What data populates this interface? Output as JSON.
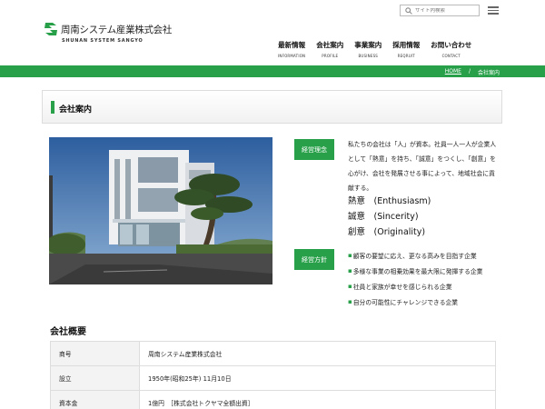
{
  "header": {
    "search": {
      "placeholder": "サイト内検索"
    },
    "logo": {
      "jp": "周南システム産業株式会社",
      "en": "SHUNAN SYSTEM SANGYO"
    },
    "nav": [
      {
        "jp": "最新情報",
        "en": "INFORMATION"
      },
      {
        "jp": "会社案内",
        "en": "PROFILE"
      },
      {
        "jp": "事業案内",
        "en": "BUSINESS"
      },
      {
        "jp": "採用情報",
        "en": "REQRUIT"
      },
      {
        "jp": "お問い合わせ",
        "en": "CONTACT"
      }
    ]
  },
  "breadcrumb": {
    "home": "HOME",
    "sep": "/",
    "current": "会社案内"
  },
  "page_title": "会社案内",
  "philosophy": {
    "label": "経営理念",
    "text": "私たちの会社は「人」が資本。社員一人一人が企業人として「熱意」を持ち、「誠意」をつくし、「創意」を心がけ、会社を発展させる事によって、地域社会に貢献する。",
    "virtues": [
      {
        "jp": "熱意",
        "en": "(Enthusiasm)"
      },
      {
        "jp": "誠意",
        "en": "(Sincerity)"
      },
      {
        "jp": "創意",
        "en": "(Originality)"
      }
    ]
  },
  "policy": {
    "label": "経営方針",
    "items": [
      "顧客の要望に応え、更なる高みを目指す企業",
      "多様な事業の相乗効果を最大限に発揮する企業",
      "社員と家族が幸せを感じられる企業",
      "自分の可能性にチャレンジできる企業"
    ]
  },
  "overview": {
    "title": "会社概要",
    "rows": [
      {
        "k": "商号",
        "v": "周南システム産業株式会社"
      },
      {
        "k": "設立",
        "v": "1950年(昭和25年) 11月10日"
      },
      {
        "k": "資本金",
        "v": "1億円　［株式会社トクヤマ全額出資］"
      }
    ]
  },
  "colors": {
    "brand_green": "#28a04a"
  }
}
